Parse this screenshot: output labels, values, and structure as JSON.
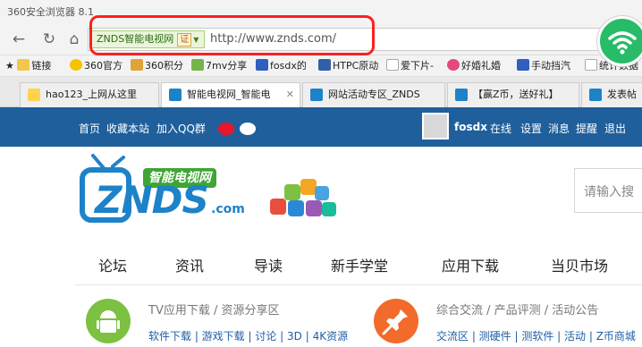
{
  "window": {
    "title": "360安全浏览器 8.1"
  },
  "addressbar": {
    "site_id": "ZNDS智能电视网",
    "cert_label": "证",
    "url": "http://www.znds.com/"
  },
  "bookmarks": [
    "链接",
    "360官方",
    "360积分",
    "7mv分享",
    "fosdx的",
    "HTPC原动",
    "爱下片-",
    "好婚礼婚",
    "手动挡汽",
    "统计数据"
  ],
  "tabs": [
    {
      "label": "hao123_上网从这里"
    },
    {
      "label": "智能电视网_智能电"
    },
    {
      "label": "网站活动专区_ZNDS"
    },
    {
      "label": "【赢Z币，送好礼】"
    },
    {
      "label": "发表帖"
    }
  ],
  "topnav": {
    "left": [
      "首页",
      "收藏本站",
      "加入QQ群"
    ],
    "username": "fosdx",
    "right": [
      "在线",
      "设置",
      "消息",
      "提醒",
      "退出"
    ]
  },
  "logo": {
    "tagline": "智能电视网",
    "brand": "ZNDS",
    "suffix": ".com"
  },
  "search": {
    "placeholder": "请输入搜"
  },
  "main_nav": [
    "论坛",
    "资讯",
    "导读",
    "新手学堂",
    "应用下载",
    "当贝市场"
  ],
  "cards": [
    {
      "title": "TV应用下载 / 资源分享区",
      "links": "软件下载 | 游戏下载 | 讨论 | 3D | 4K资源"
    },
    {
      "title": "综合交流 / 产品评测 / 活动公告",
      "links": "交流区 | 测硬件 | 测软件 | 活动 | Z币商城"
    }
  ],
  "colors": {
    "topnav": "#1f5f9b",
    "highlight": "#ff1f1f",
    "wifi": "#29bc68",
    "logo_blue": "#1e82c8",
    "logo_green": "#3fa535"
  }
}
